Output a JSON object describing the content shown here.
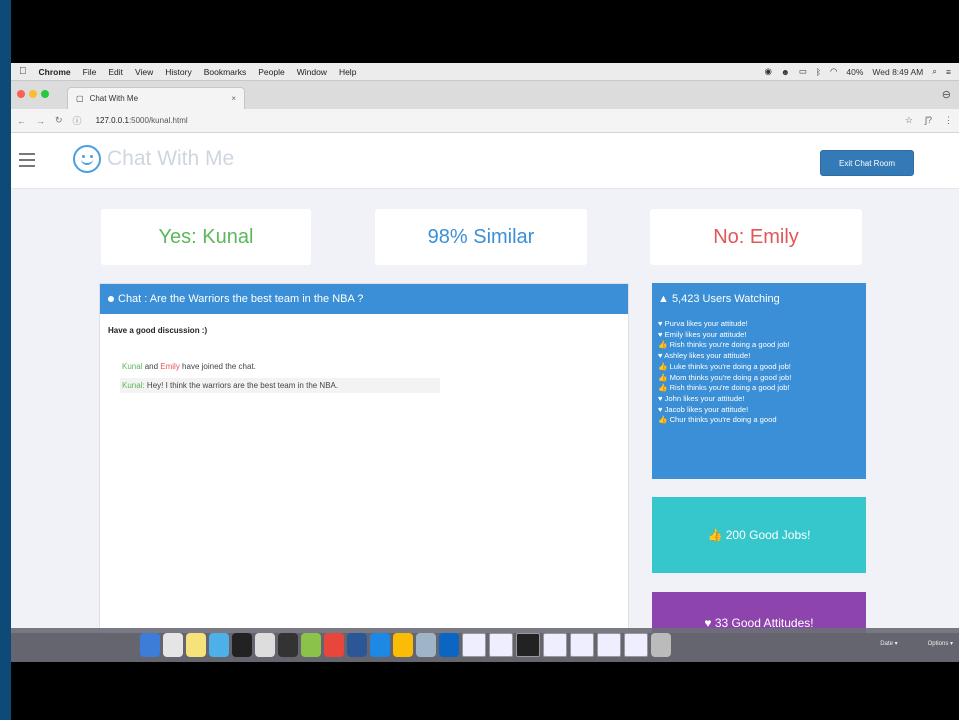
{
  "menubar": {
    "items": [
      "Chrome",
      "File",
      "Edit",
      "View",
      "History",
      "Bookmarks",
      "People",
      "Window",
      "Help"
    ],
    "battery": "40%",
    "clock": "Wed 8:49 AM"
  },
  "browser": {
    "tab_title": "Chat With Me",
    "tab_close": "×",
    "url_host": "127.0.0.1",
    "url_path": ":5000/kunal.html"
  },
  "app": {
    "brand": "Chat With Me",
    "exit_button": "Exit Chat Room",
    "yes_label": "Yes: Kunal",
    "similarity": "98% Similar",
    "no_label": "No: Emily"
  },
  "chat": {
    "header": "Chat : Are the Warriors the best team in the NBA ?",
    "intro": "Have a good discussion :)",
    "joined": {
      "name1": "Kunal",
      "and": " and ",
      "name2": "Emily",
      "rest": " have joined the chat."
    },
    "messages": [
      {
        "name": "Kunal:",
        "text": " Hey! I think the warriors are the best team in the NBA."
      }
    ]
  },
  "watchers": {
    "title": "▲ 5,423 Users Watching",
    "feed": [
      "♥ Purva likes your attitude!",
      "♥ Emily likes your attitude!",
      "👍 Rish thinks you're doing a good job!",
      "♥ Ashley likes your attitude!",
      "👍 Luke thinks you're doing a good job!",
      "👍 Mom thinks you're doing a good job!",
      "👍 Rish thinks you're doing a good job!",
      "♥ John likes your attitude!",
      "♥ Jacob likes your attitude!",
      "👍 Chur thinks you're doing a good"
    ]
  },
  "good_jobs": "👍 200 Good Jobs!",
  "good_attitudes": "♥ 33 Good Attitudes!",
  "dock": {
    "right_label_1": "Date ▾",
    "right_label_2": "Options ▾"
  },
  "colors": {
    "primary": "#3a8fd6",
    "yes_green": "#5cb85c",
    "no_red": "#e05757",
    "teal": "#35c7cc",
    "purple": "#8e44ad"
  }
}
